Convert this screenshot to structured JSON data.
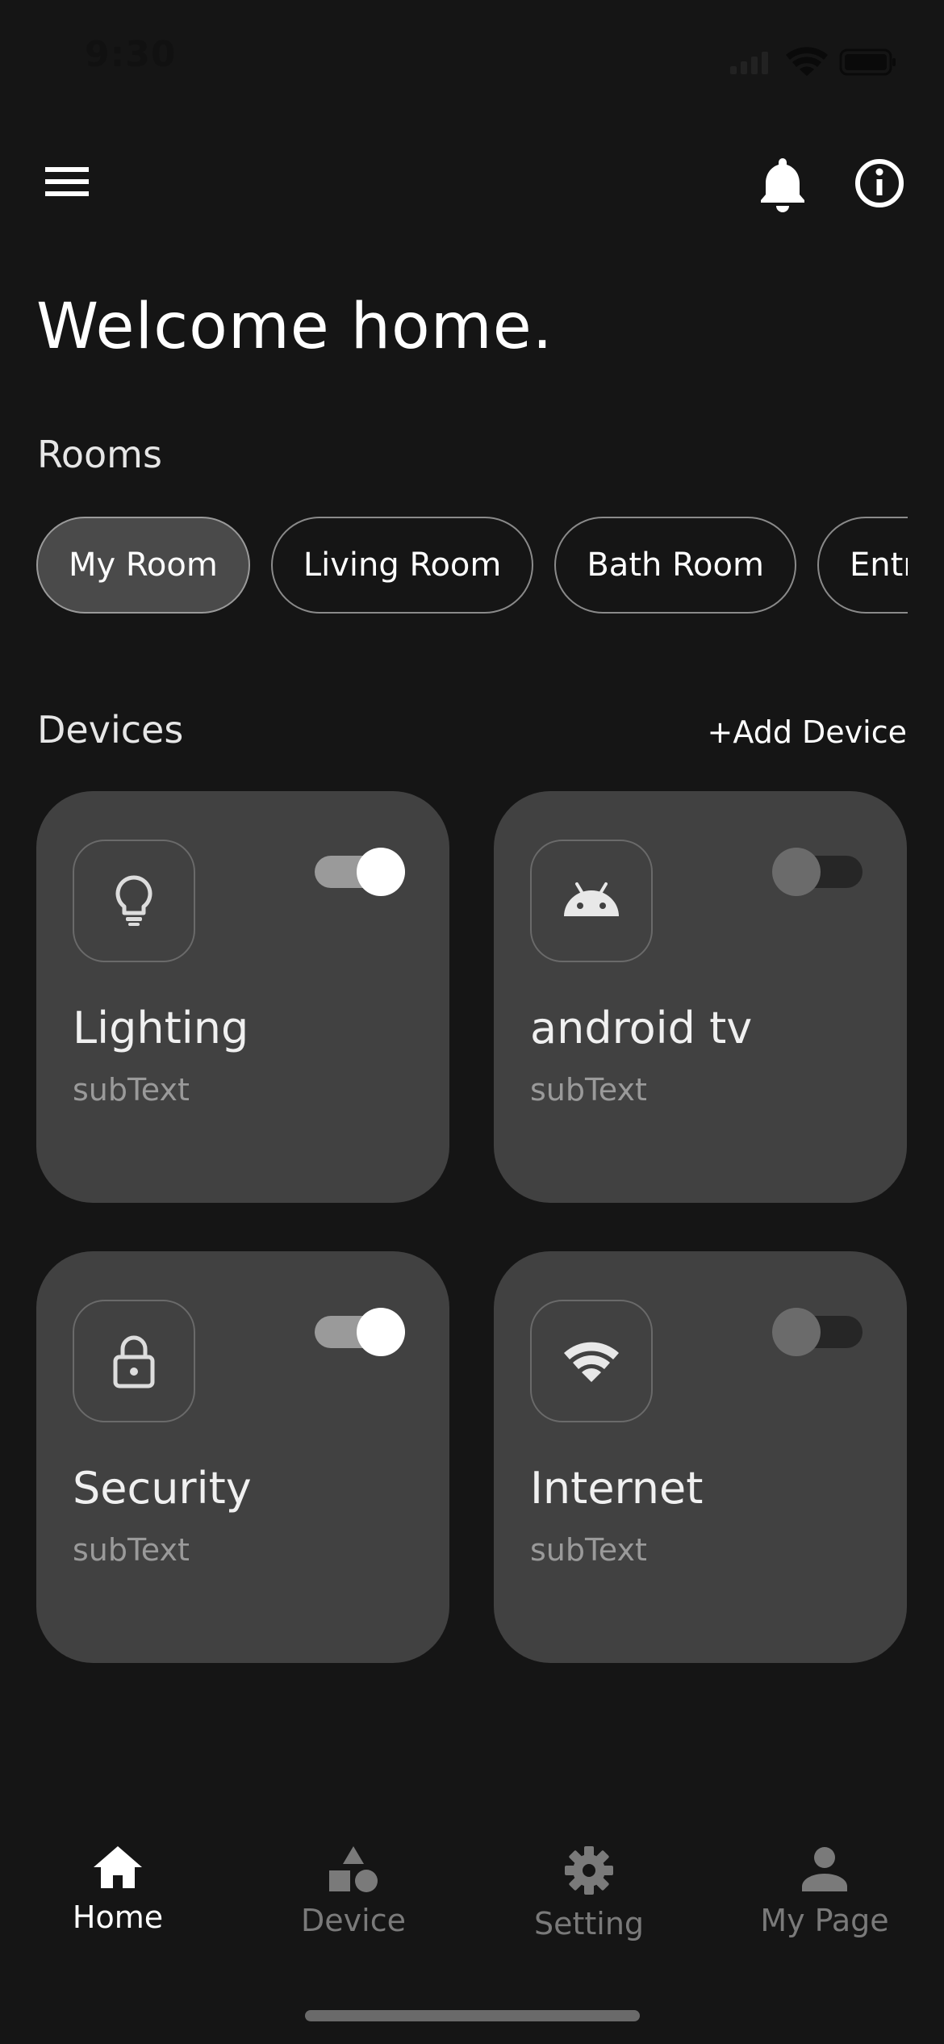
{
  "status_bar": {
    "time": "9:30"
  },
  "header": {
    "welcome": "Welcome home."
  },
  "rooms": {
    "label": "Rooms",
    "items": [
      "My Room",
      "Living Room",
      "Bath Room",
      "Entrance"
    ],
    "selected": "My Room"
  },
  "devices": {
    "label": "Devices",
    "add_label": "+Add Device",
    "items": [
      {
        "name": "Lighting",
        "sub": "subText",
        "icon": "lightbulb-icon",
        "on": true
      },
      {
        "name": "android tv",
        "sub": "subText",
        "icon": "android-icon",
        "on": false
      },
      {
        "name": "Security",
        "sub": "subText",
        "icon": "lock-icon",
        "on": true
      },
      {
        "name": "Internet",
        "sub": "subText",
        "icon": "wifi-icon",
        "on": false
      }
    ]
  },
  "nav": {
    "items": [
      {
        "label": "Home",
        "icon": "home-icon",
        "active": true
      },
      {
        "label": "Device",
        "icon": "shapes-icon",
        "active": false
      },
      {
        "label": "Setting",
        "icon": "gear-icon",
        "active": false
      },
      {
        "label": "My Page",
        "icon": "person-icon",
        "active": false
      }
    ]
  },
  "colors": {
    "background": "#151515",
    "card": "#414141",
    "chip_active": "#4a4a4a",
    "accent": "#ffffff"
  }
}
